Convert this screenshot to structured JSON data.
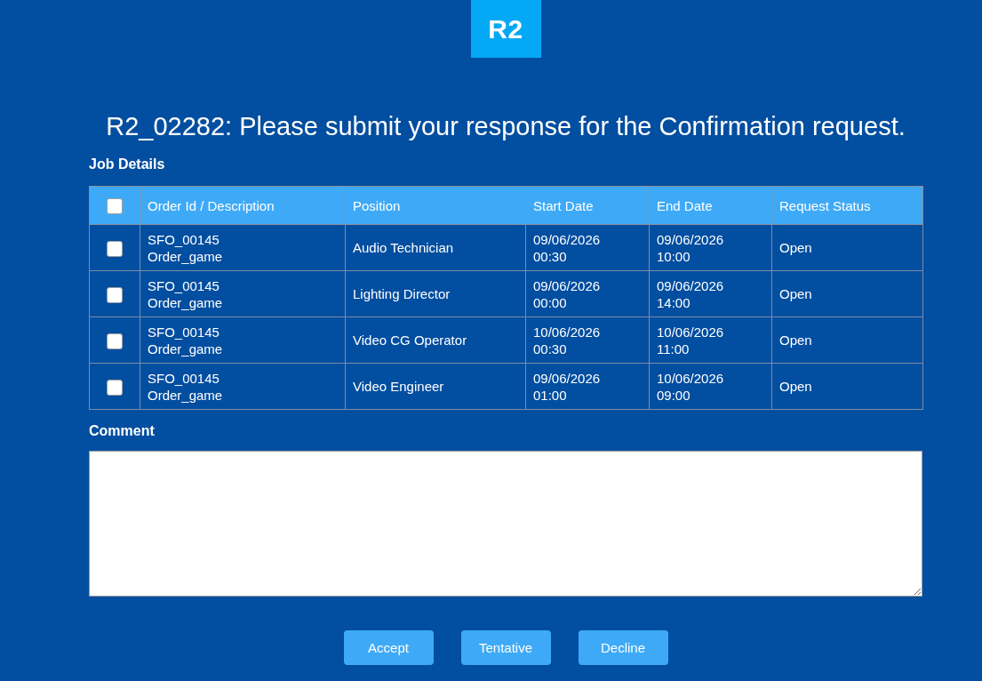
{
  "logo": {
    "text": "R2"
  },
  "title": "R2_02282: Please submit your response for the Confirmation request.",
  "job_details": {
    "heading": "Job Details",
    "select_all": {
      "checked": false
    },
    "columns": [
      "Order Id / Description",
      "Position",
      "Start Date",
      "End Date",
      "Request Status"
    ],
    "rows": [
      {
        "checked": false,
        "order_id": "SFO_00145",
        "description": "Order_game",
        "position": "Audio Technician",
        "start_date": "09/06/2026",
        "start_time": "00:30",
        "end_date": "09/06/2026",
        "end_time": "10:00",
        "status": "Open"
      },
      {
        "checked": false,
        "order_id": "SFO_00145",
        "description": "Order_game",
        "position": "Lighting Director",
        "start_date": "09/06/2026",
        "start_time": "00:00",
        "end_date": "09/06/2026",
        "end_time": "14:00",
        "status": "Open"
      },
      {
        "checked": false,
        "order_id": "SFO_00145",
        "description": "Order_game",
        "position": "Video CG Operator",
        "start_date": "10/06/2026",
        "start_time": "00:30",
        "end_date": "10/06/2026",
        "end_time": "11:00",
        "status": "Open"
      },
      {
        "checked": false,
        "order_id": "SFO_00145",
        "description": "Order_game",
        "position": "Video Engineer",
        "start_date": "09/06/2026",
        "start_time": "01:00",
        "end_date": "10/06/2026",
        "end_time": "09:00",
        "status": "Open"
      }
    ]
  },
  "comment": {
    "label": "Comment"
  },
  "buttons": [
    "Accept",
    "Tentative",
    "Decline"
  ]
}
